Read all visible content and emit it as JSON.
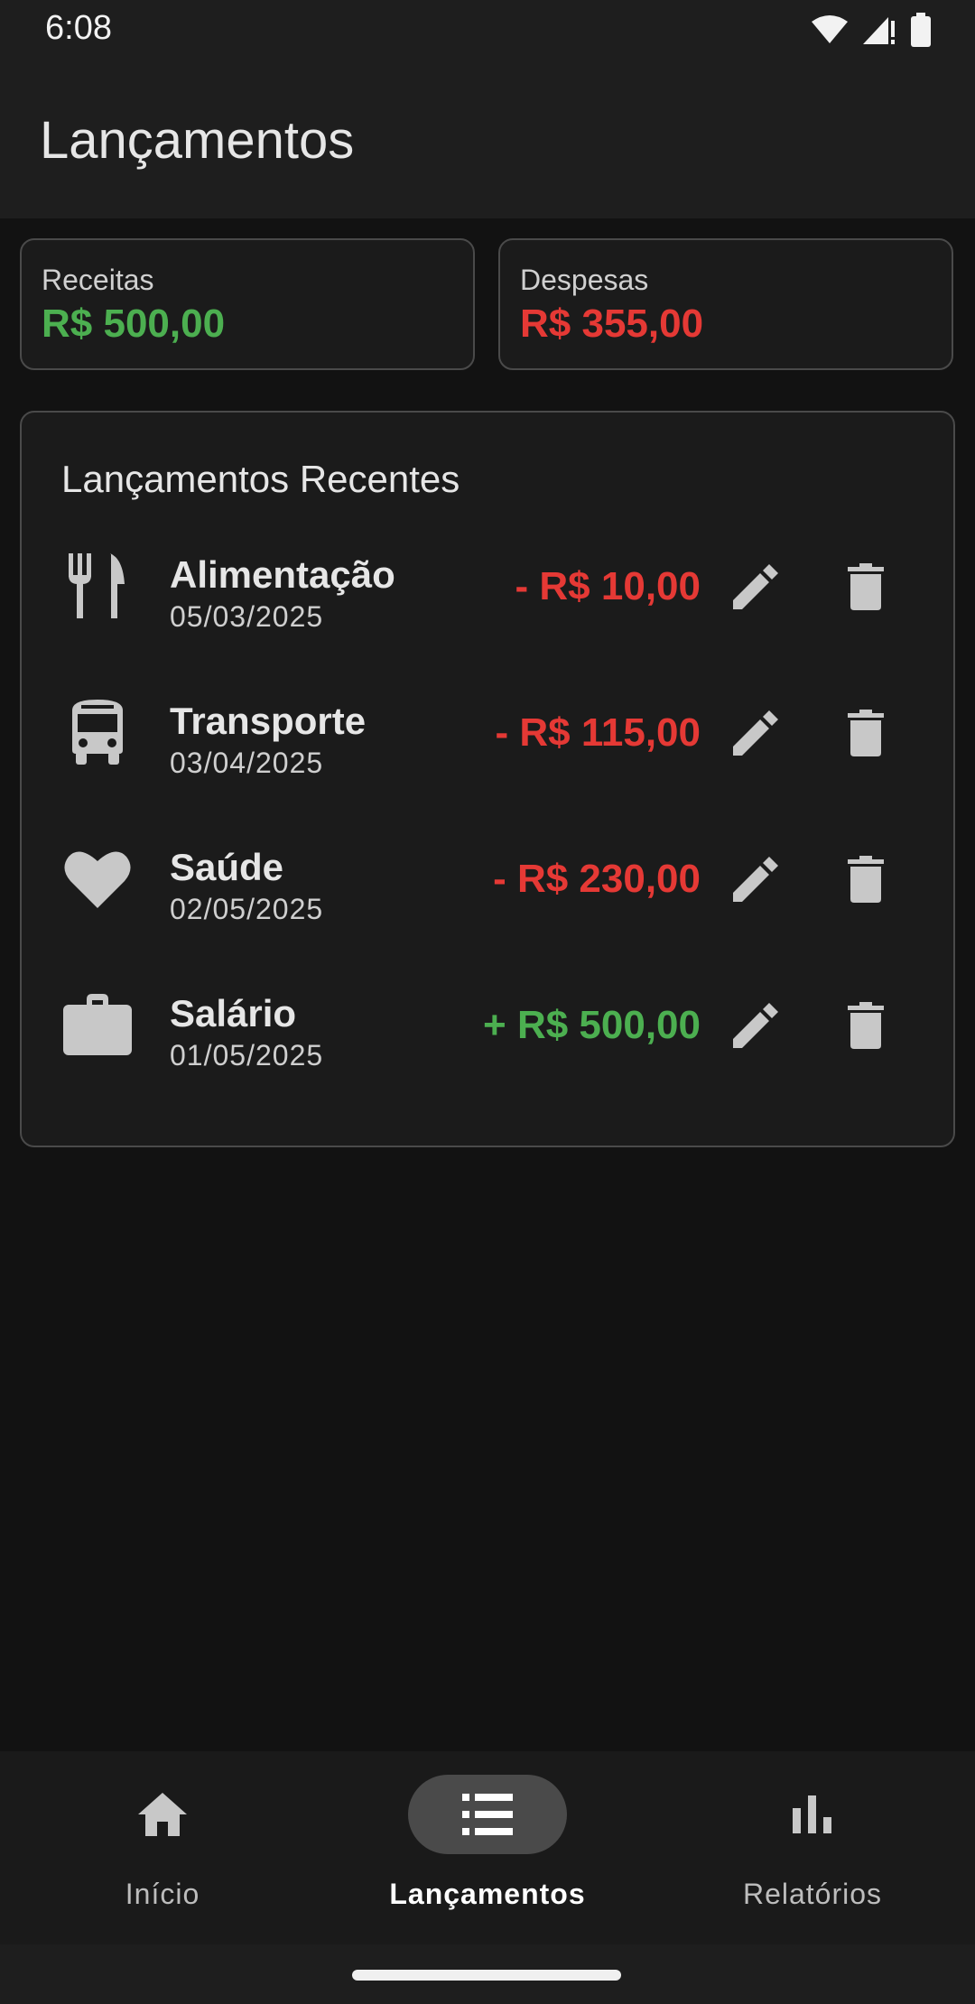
{
  "status_bar": {
    "time": "6:08"
  },
  "app_bar": {
    "title": "Lançamentos"
  },
  "summary": {
    "income": {
      "label": "Receitas",
      "value": "R$ 500,00",
      "color": "#4caf50"
    },
    "expenses": {
      "label": "Despesas",
      "value": "R$ 355,00",
      "color": "#e53935"
    }
  },
  "recent": {
    "title": "Lançamentos Recentes",
    "transactions": [
      {
        "icon": "restaurant-icon",
        "name": "Alimentação",
        "date": "05/03/2025",
        "amount": "- R$ 10,00",
        "type": "expense"
      },
      {
        "icon": "bus-icon",
        "name": "Transporte",
        "date": "03/04/2025",
        "amount": "- R$ 115,00",
        "type": "expense"
      },
      {
        "icon": "heart-icon",
        "name": "Saúde",
        "date": "02/05/2025",
        "amount": "- R$ 230,00",
        "type": "expense"
      },
      {
        "icon": "briefcase-icon",
        "name": "Salário",
        "date": "01/05/2025",
        "amount": "+ R$ 500,00",
        "type": "income"
      }
    ]
  },
  "bottom_nav": {
    "items": [
      {
        "label": "Início",
        "icon": "home-icon",
        "active": false
      },
      {
        "label": "Lançamentos",
        "icon": "list-icon",
        "active": true
      },
      {
        "label": "Relatórios",
        "icon": "bar-chart-icon",
        "active": false
      }
    ]
  },
  "colors": {
    "income": "#4caf50",
    "expense": "#e53935",
    "background": "#121212",
    "surface": "#1b1b1b"
  }
}
